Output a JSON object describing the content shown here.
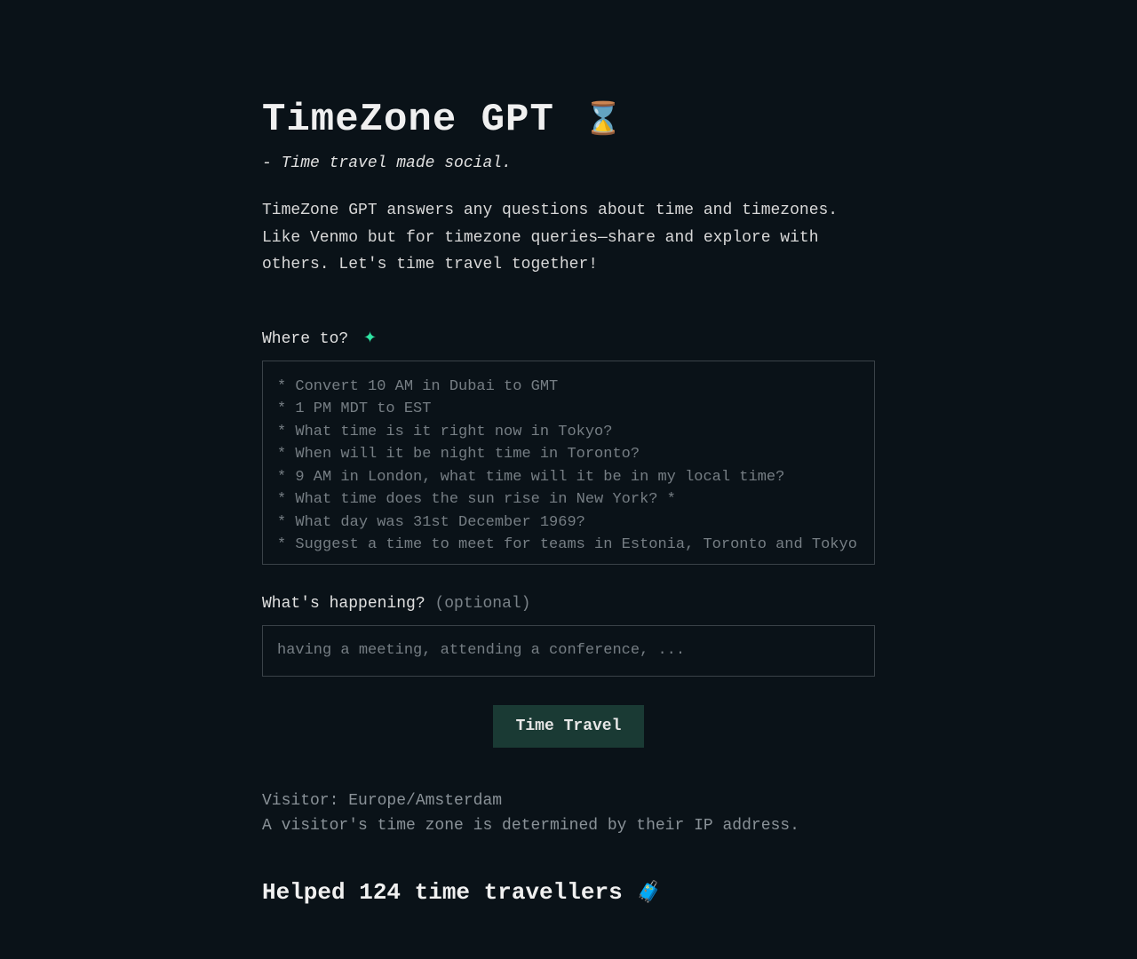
{
  "header": {
    "title": "TimeZone GPT",
    "tagline": "- Time travel made social.",
    "intro": "TimeZone GPT answers any questions about time and timezones. Like Venmo but for timezone queries—share and explore with others. Let's time travel together!"
  },
  "query": {
    "label": "Where to?",
    "placeholder": "* Convert 10 AM in Dubai to GMT\n* 1 PM MDT to EST\n* What time is it right now in Tokyo?\n* When will it be night time in Toronto?\n* 9 AM in London, what time will it be in my local time?\n* What time does the sun rise in New York? *\n* What day was 31st December 1969?\n* Suggest a time to meet for teams in Estonia, Toronto and Tokyo"
  },
  "context": {
    "label": "What's happening?",
    "optional": "(optional)",
    "placeholder": "having a meeting, attending a conference, ..."
  },
  "submit": {
    "label": "Time Travel"
  },
  "visitor": {
    "line": "Visitor: Europe/Amsterdam",
    "note": "A visitor's time zone is determined by their IP address."
  },
  "stats": {
    "heading": "Helped 124 time travellers "
  },
  "icons": {
    "title_accent": "⌛",
    "label_accent": "✦",
    "stats_emoji": "🧳"
  }
}
